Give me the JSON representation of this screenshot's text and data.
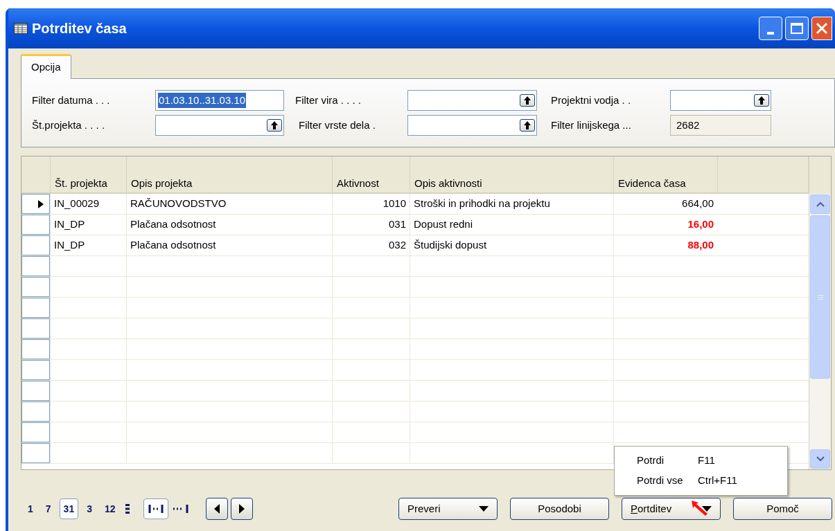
{
  "window": {
    "title": "Potrditev časa"
  },
  "tabs": [
    {
      "label": "Opcija",
      "selected": true
    }
  ],
  "filters": [
    {
      "label": "Filter datuma . . .",
      "value": "01.03.10..31.03.10",
      "kind": "selected"
    },
    {
      "label": "Filter vira . . . .",
      "kind": "lookup"
    },
    {
      "label": "Projektni vodja . .",
      "kind": "lookup"
    },
    {
      "label": "Št.projekta . . . .",
      "kind": "lookup"
    },
    {
      "label": "Filter vrste dela .",
      "kind": "lookup"
    },
    {
      "label": "Filter linijskega ...",
      "value": "2682",
      "kind": "readonly"
    }
  ],
  "table": {
    "columns": [
      "Št. projekta",
      "Opis projekta",
      "Aktivnost",
      "Opis aktivnosti",
      "Evidenca časa"
    ],
    "rows": [
      {
        "current": true,
        "cells": [
          "IN_00029",
          "RAČUNOVODSTVO",
          "1010",
          "Stroški in prihodki na projektu",
          "664,00"
        ],
        "warning": false
      },
      {
        "current": false,
        "cells": [
          "IN_DP",
          "Plačana odsotnost",
          "031",
          "Dopust redni",
          "16,00"
        ],
        "warning": true
      },
      {
        "current": false,
        "cells": [
          "IN_DP",
          "Plačana odsotnost",
          "032",
          "Študijski dopust",
          "88,00"
        ],
        "warning": true
      }
    ]
  },
  "periods": [
    {
      "label": "1",
      "selected": false
    },
    {
      "label": "7",
      "selected": false
    },
    {
      "label": "31",
      "selected": true
    },
    {
      "label": "3",
      "selected": false
    },
    {
      "label": "12",
      "selected": false
    }
  ],
  "buttons": [
    {
      "label": "Preveri",
      "dropdown": true
    },
    {
      "label": "Posodobi",
      "dropdown": false
    },
    {
      "label": "Portditev",
      "dropdown": true
    },
    {
      "label": "Pomoč",
      "dropdown": false
    }
  ],
  "menu": [
    {
      "label": "Potrdi",
      "shortcut": "F11"
    },
    {
      "label": "Potrdi vse",
      "shortcut": "Ctrl+F11"
    }
  ]
}
